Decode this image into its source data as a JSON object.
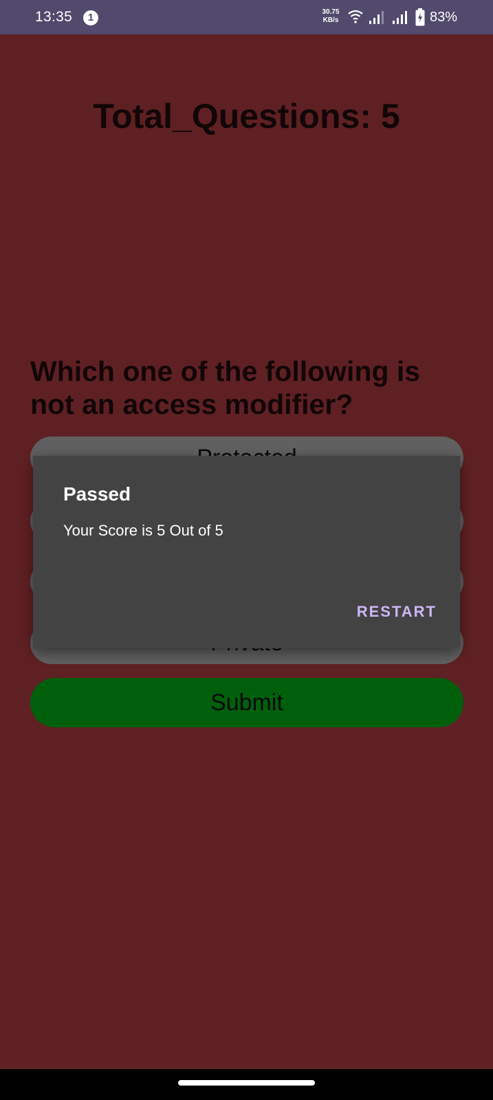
{
  "status_bar": {
    "time": "13:35",
    "notification_count": "1",
    "net_speed_value": "30.75",
    "net_speed_unit": "KB/s",
    "battery_percent": "83%",
    "icons": [
      "wifi-icon",
      "signal-icon",
      "signal-icon",
      "battery-charging-icon"
    ]
  },
  "quiz": {
    "total_questions_label": "Total_Questions: 5",
    "question": "Which one of the following is not an access modifier?",
    "options": [
      {
        "label": "Protected"
      },
      {
        "label": ""
      },
      {
        "label": ""
      },
      {
        "label": "Private"
      }
    ],
    "submit_label": "Submit"
  },
  "dialog": {
    "title": "Passed",
    "message": "Your Score is 5 Out of 5",
    "button_label": "RESTART"
  },
  "colors": {
    "background": "#5f2023",
    "status_bar": "#514a6c",
    "option": "#606060",
    "submit": "#005f0b",
    "dialog": "#434343",
    "dialog_button": "#cdb6f6"
  }
}
